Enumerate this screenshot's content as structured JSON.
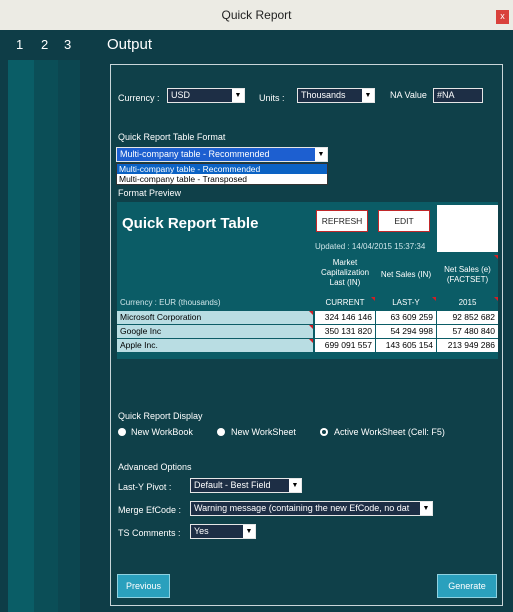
{
  "window": {
    "title": "Quick Report",
    "close_glyph": "x"
  },
  "steps": {
    "s1": "1",
    "s2": "2",
    "s3": "3",
    "current": "Output"
  },
  "settings": {
    "currency_label": "Currency :",
    "currency_value": "USD",
    "units_label": "Units :",
    "units_value": "Thousands",
    "na_label": "NA Value",
    "na_value": "#NA"
  },
  "format": {
    "label": "Quick Report Table Format",
    "selected": "Multi-company table - Recommended",
    "options": [
      "Multi-company table - Recommended",
      "Multi-company table - Transposed"
    ],
    "preview_label": "Format Preview"
  },
  "preview": {
    "title": "Quick Report Table",
    "refresh_label": "REFRESH",
    "edit_label": "EDIT",
    "updated": "Updated : 14/04/2015 15:37:34",
    "currency_line": "Currency : EUR  (thousands)",
    "headers": [
      {
        "name": "Market Capitalization Last (IN)",
        "sub": "CURRENT"
      },
      {
        "name": "Net Sales (IN)",
        "sub": "LAST-Y"
      },
      {
        "name": "Net Sales (e) (FACTSET)",
        "sub": "2015"
      }
    ],
    "rows": [
      {
        "company": "Microsoft Corporation",
        "values": [
          "324 146 146",
          "63 609 259",
          "92 852 682"
        ]
      },
      {
        "company": "Google Inc",
        "values": [
          "350 131 820",
          "54 294 998",
          "57 480 840"
        ]
      },
      {
        "company": "Apple Inc.",
        "values": [
          "699 091 557",
          "143 605 154",
          "213 949 286"
        ]
      }
    ]
  },
  "display": {
    "label": "Quick Report Display",
    "options": [
      "New WorkBook",
      "New WorkSheet",
      "Active WorkSheet (Cell: F5)"
    ],
    "selected_index": 2
  },
  "advanced": {
    "label": "Advanced Options",
    "lasty_label": "Last-Y Pivot :",
    "lasty_value": "Default - Best Field",
    "merge_label": "Merge EfCode :",
    "merge_value": "Warning message (containing the new EfCode, no dat",
    "ts_label": "TS Comments :",
    "ts_value": "Yes"
  },
  "nav": {
    "previous": "Previous",
    "generate": "Generate"
  },
  "colors": {
    "panel": "#0f4049",
    "accent": "#2aa0bd",
    "preview_bg": "#0b5c66",
    "row_label_bg": "#b9dde3",
    "flag": "#d31f24"
  },
  "icons": {
    "dropdown": "chevron-down-icon",
    "close": "close-icon"
  }
}
